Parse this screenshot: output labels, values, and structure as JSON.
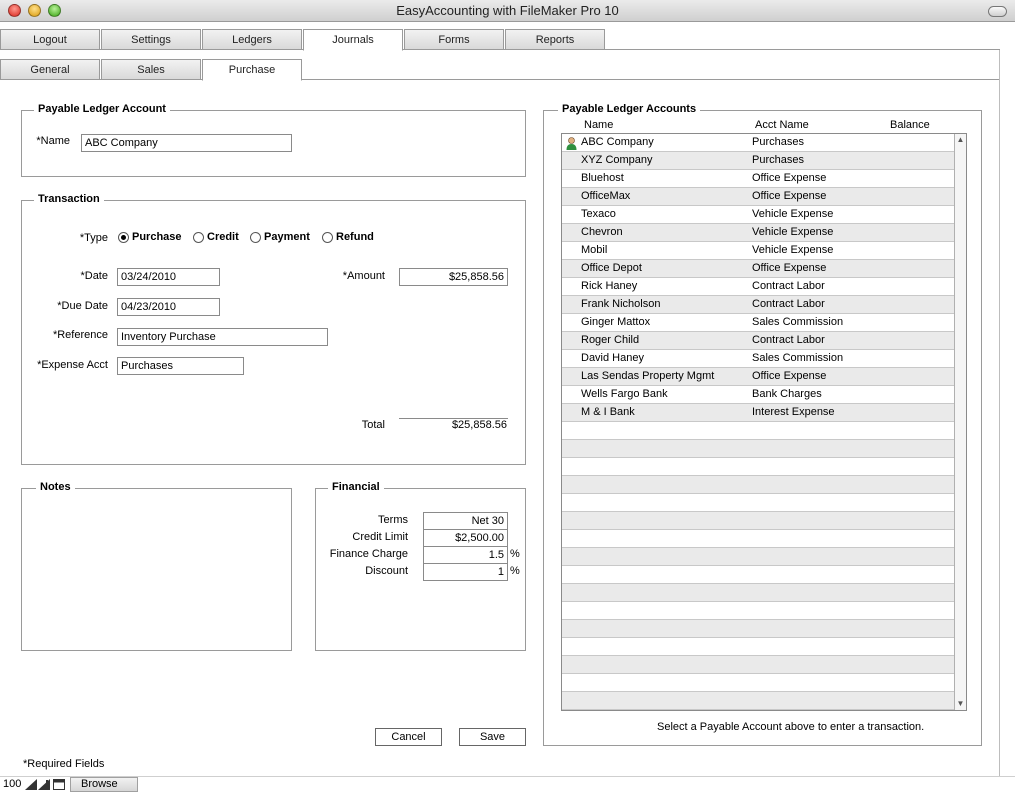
{
  "window": {
    "title": "EasyAccounting with FileMaker Pro 10"
  },
  "main_tabs": [
    {
      "label": "Logout"
    },
    {
      "label": "Settings"
    },
    {
      "label": "Ledgers"
    },
    {
      "label": "Journals"
    },
    {
      "label": "Forms"
    },
    {
      "label": "Reports"
    }
  ],
  "sub_tabs": [
    {
      "label": "General"
    },
    {
      "label": "Sales"
    },
    {
      "label": "Purchase"
    }
  ],
  "payable_account": {
    "legend": "Payable Ledger Account",
    "name_label": "*Name",
    "name_value": "ABC Company"
  },
  "transaction": {
    "legend": "Transaction",
    "type_label": "*Type",
    "types": [
      {
        "label": "Purchase",
        "selected": true
      },
      {
        "label": "Credit",
        "selected": false
      },
      {
        "label": "Payment",
        "selected": false
      },
      {
        "label": "Refund",
        "selected": false
      }
    ],
    "date_label": "*Date",
    "date_value": "03/24/2010",
    "amount_label": "*Amount",
    "amount_value": "$25,858.56",
    "due_date_label": "*Due Date",
    "due_date_value": "04/23/2010",
    "reference_label": "*Reference",
    "reference_value": "Inventory Purchase",
    "expense_label": "*Expense Acct",
    "expense_value": "Purchases",
    "total_label": "Total",
    "total_value": "$25,858.56"
  },
  "notes": {
    "legend": "Notes"
  },
  "financial": {
    "legend": "Financial",
    "terms_label": "Terms",
    "terms_value": "Net 30",
    "credit_limit_label": "Credit Limit",
    "credit_limit_value": "$2,500.00",
    "finance_charge_label": "Finance Charge",
    "finance_charge_value": "1.5",
    "finance_charge_unit": "%",
    "discount_label": "Discount",
    "discount_value": "1",
    "discount_unit": "%"
  },
  "buttons": {
    "cancel": "Cancel",
    "save": "Save"
  },
  "accounts_panel": {
    "legend": "Payable Ledger Accounts",
    "columns": [
      "Name",
      "Acct Name",
      "Balance"
    ],
    "rows": [
      {
        "name": "ABC Company",
        "acct": "Purchases",
        "balance": "",
        "icon": "person-icon"
      },
      {
        "name": "XYZ Company",
        "acct": "Purchases",
        "balance": ""
      },
      {
        "name": "Bluehost",
        "acct": "Office Expense",
        "balance": ""
      },
      {
        "name": "OfficeMax",
        "acct": "Office Expense",
        "balance": ""
      },
      {
        "name": "Texaco",
        "acct": "Vehicle Expense",
        "balance": ""
      },
      {
        "name": "Chevron",
        "acct": "Vehicle Expense",
        "balance": ""
      },
      {
        "name": "Mobil",
        "acct": "Vehicle Expense",
        "balance": ""
      },
      {
        "name": "Office Depot",
        "acct": "Office Expense",
        "balance": ""
      },
      {
        "name": "Rick Haney",
        "acct": "Contract Labor",
        "balance": ""
      },
      {
        "name": "Frank Nicholson",
        "acct": "Contract Labor",
        "balance": ""
      },
      {
        "name": "Ginger Mattox",
        "acct": "Sales Commission",
        "balance": ""
      },
      {
        "name": "Roger Child",
        "acct": "Contract Labor",
        "balance": ""
      },
      {
        "name": "David Haney",
        "acct": "Sales Commission",
        "balance": ""
      },
      {
        "name": "Las Sendas Property Mgmt",
        "acct": "Office Expense",
        "balance": ""
      },
      {
        "name": "Wells Fargo Bank",
        "acct": "Bank Charges",
        "balance": ""
      },
      {
        "name": "M & I Bank",
        "acct": "Interest Expense",
        "balance": ""
      }
    ],
    "hint": "Select a Payable Account above to enter a transaction."
  },
  "required_note": "*Required Fields",
  "statusbar": {
    "zoom": "100",
    "mode": "Browse"
  },
  "colors": {
    "row_alt": "#eaeaea",
    "border": "#9a9a9a"
  }
}
